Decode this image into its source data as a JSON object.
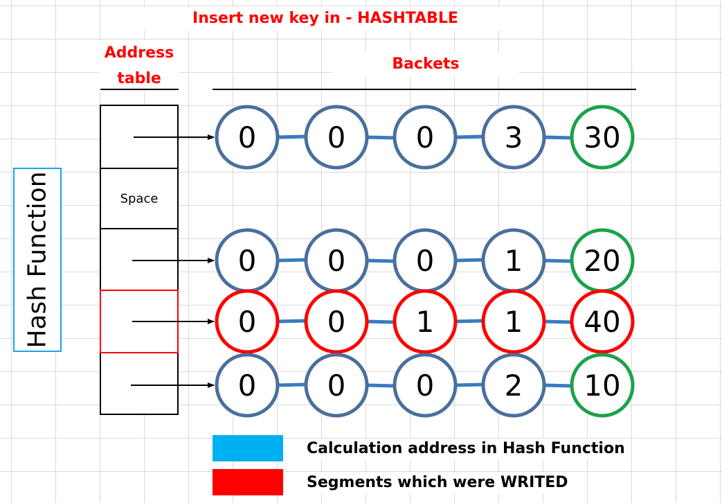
{
  "title": "Insert new key in - HASHTABLE",
  "address_table": {
    "label": "Address\ntable",
    "label_line1": "Address",
    "label_line2": "table",
    "space_label": "Space"
  },
  "buckets_label": "Backets",
  "hash_function_label": "Hash Function",
  "colors": {
    "title_red": "#ff0000",
    "node_default": "#4a6f9c",
    "node_terminal": "#1aa24a",
    "node_written": "#ff0000",
    "link": "#3a7bc0",
    "hash_box": "#1aa3e8"
  },
  "rows": [
    {
      "nodes": [
        "0",
        "0",
        "0",
        "3",
        "30"
      ],
      "written": false
    },
    {
      "nodes": [
        "0",
        "0",
        "0",
        "1",
        "20"
      ],
      "written": false
    },
    {
      "nodes": [
        "0",
        "0",
        "1",
        "1",
        "40"
      ],
      "written": true
    },
    {
      "nodes": [
        "0",
        "0",
        "0",
        "2",
        "10"
      ],
      "written": false
    }
  ],
  "legend": [
    {
      "color": "#00b0f0",
      "text": "Calculation address in Hash Function"
    },
    {
      "color": "#ff0000",
      "text": "Segments which were WRITED"
    }
  ]
}
